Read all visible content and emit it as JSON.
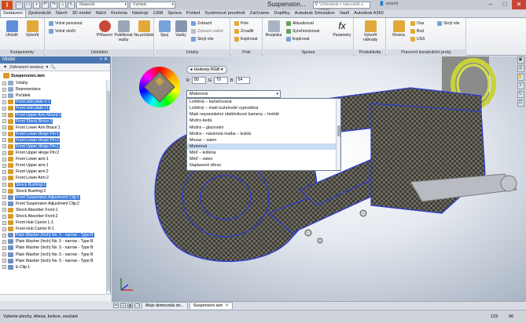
{
  "window": {
    "title": "Suspension...",
    "search_placeholder": "Vyhledávat v nápovědě a příkaz",
    "user": "vmichl",
    "material_combo": "Materiál",
    "appearance_combo": "Vzhled"
  },
  "tabs": [
    "Sestavení",
    "Zjednodušit",
    "Návrh",
    "3D model",
    "Náčrt",
    "Kontrola",
    "Nástroje",
    "CAM",
    "Správa",
    "Pohled",
    "Systémové prostředí",
    "Začínáme",
    "Doplňky",
    "Autodesk Simulation",
    "Vault",
    "Autodesk A360"
  ],
  "active_tab": "Sestavení",
  "ribbon": {
    "panels": [
      {
        "title": "Komponenty",
        "buttons": [
          "Umístit",
          "Vytvořit"
        ]
      },
      {
        "title": "Umístění",
        "buttons": [
          "Volné posunout",
          "Volné otočit",
          "Přiřazení",
          "Publikovat vazby",
          "Na počátek"
        ]
      },
      {
        "title": "Vztahy",
        "buttons": [
          "Spoj",
          "Vazby",
          "Zobrazit",
          "Zobrazit vadné",
          "Skrýt vše"
        ]
      },
      {
        "title": "Pole",
        "buttons": [
          "Pole",
          "Zrcadlit",
          "Kopírovat"
        ]
      },
      {
        "title": "Správa",
        "buttons": [
          "Rozpiska",
          "Aktualizovat",
          "Synchronizovat",
          "Kopírovat",
          "Parametry"
        ]
      },
      {
        "title": "Produktivita",
        "buttons": [
          "Vytvořit náhrady"
        ]
      },
      {
        "title": "Pracovní konstrukční prvky",
        "buttons": [
          "Rovina",
          "Osa",
          "Bod",
          "USS",
          "Skrýt vše"
        ]
      }
    ]
  },
  "browser": {
    "title": "Model",
    "toolbar_label": "Zobrazení sestavy",
    "root": "Suspension.iam",
    "items": [
      {
        "label": "Vztahy",
        "selected": false
      },
      {
        "label": "Reprezentace",
        "selected": false
      },
      {
        "label": "Počátek",
        "selected": false
      },
      {
        "label": "Front side plate n:1",
        "selected": true
      },
      {
        "label": "Front side plate l:1",
        "selected": true
      },
      {
        "label": "Front Upper Arm Mount:1",
        "selected": true
      },
      {
        "label": "Front Shock Brace:1",
        "selected": true
      },
      {
        "label": "Front Lower Arm Brace:1",
        "selected": false
      },
      {
        "label": "Front Lower Hinge Pin:1",
        "selected": true
      },
      {
        "label": "Front Lower Hinge Pin:2",
        "selected": true
      },
      {
        "label": "Front Upper Hinge Pin:1",
        "selected": true
      },
      {
        "label": "Front Upper Hinge Pin:2",
        "selected": false
      },
      {
        "label": "Front Lower arm:1",
        "selected": false
      },
      {
        "label": "Front Upper arm:1",
        "selected": false
      },
      {
        "label": "Front Upper arm:2",
        "selected": false
      },
      {
        "label": "Front Lower Arm:2",
        "selected": false
      },
      {
        "label": "Shock Bushing:1",
        "selected": true
      },
      {
        "label": "Shock Bushing:2",
        "selected": false
      },
      {
        "label": "Front Suspension Adjustment Clip:1",
        "selected": true
      },
      {
        "label": "Front Suspension Adjustment Clip:2",
        "selected": false
      },
      {
        "label": "Shock Absorber Front:1",
        "selected": false
      },
      {
        "label": "Shock Absorber Front:2",
        "selected": false
      },
      {
        "label": "Front Hub Carrier L:1",
        "selected": false
      },
      {
        "label": "Front Hub Carrier R:1",
        "selected": false
      },
      {
        "label": "Plain Washer (Inch) No. 5 - narrow - Type B",
        "selected": true
      },
      {
        "label": "Plain Washer (Inch) No. 5 - narrow - Type B",
        "selected": false
      },
      {
        "label": "Plain Washer (Inch) No. 5 - narrow - Type B",
        "selected": false
      },
      {
        "label": "Plain Washer (Inch) No. 5 - narrow - Type B",
        "selected": false
      },
      {
        "label": "Plain Washer (Inch) No. 5 - narrow - Type B",
        "selected": false
      },
      {
        "label": "E-Clip:1",
        "selected": false
      }
    ]
  },
  "color_editor": {
    "mode_label": "Hodnoty RGB",
    "r_label": "R",
    "g_label": "G",
    "b_label": "B",
    "r_value": "80",
    "g_value": "79",
    "b_value": "64",
    "material_value": "Motorová",
    "options": [
      "Leštěná – kartáčovaná",
      "Leštěný – malé kuželovité vypouklina",
      "Malé nepravidelné obdélníkové kameny – hnědé",
      "Modro-šedá",
      "Modrá – glazování",
      "Modrá – nástenná malba – lesklá",
      "Mosaz – saten",
      "Motorová",
      "Měď – leštěná",
      "Měď – saten",
      "Naplavené dřevo"
    ],
    "selected_option": "Motorová"
  },
  "doc_tabs": [
    "Moje domovská str...",
    "Suspension.iam"
  ],
  "active_doc_tab": "Suspension.iam",
  "status": {
    "text": "Vyberte plochy, tělesa, funkce, součást",
    "n1": "123",
    "n2": "56"
  },
  "colors": {
    "selection": "#3b7ad8",
    "highlight_edges": "#2a3bd8",
    "title_blue": "#4a77b0"
  }
}
